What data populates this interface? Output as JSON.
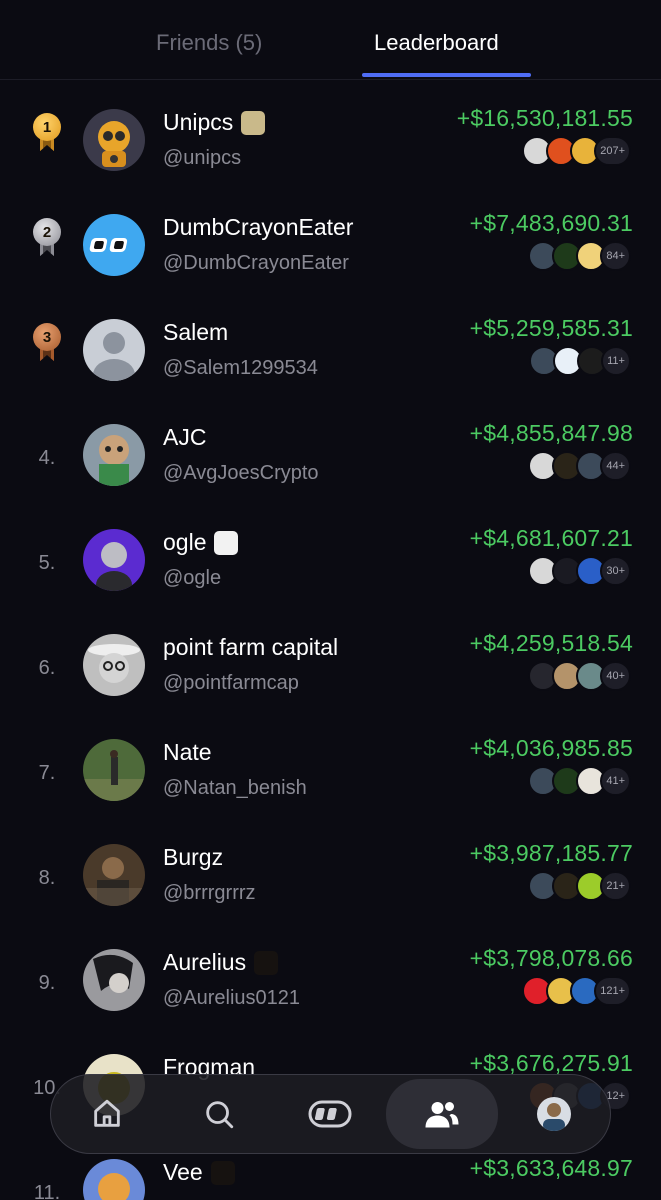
{
  "tabs": {
    "friends": "Friends (5)",
    "leaderboard": "Leaderboard"
  },
  "accent_color": "#4f6df5",
  "gain_color": "#4ccb62",
  "rows": [
    {
      "rank": "1",
      "name": "Unipcs",
      "handle": "@unipcs",
      "amount": "+$16,530,181.55",
      "more": "207+",
      "medal": "gold"
    },
    {
      "rank": "2",
      "name": "DumbCrayonEater",
      "handle": "@DumbCrayonEater",
      "amount": "+$7,483,690.31",
      "more": "84+",
      "medal": "silver"
    },
    {
      "rank": "3",
      "name": "Salem",
      "handle": "@Salem1299534",
      "amount": "+$5,259,585.31",
      "more": "11+",
      "medal": "bronze"
    },
    {
      "rank": "4.",
      "name": "AJC",
      "handle": "@AvgJoesCrypto",
      "amount": "+$4,855,847.98",
      "more": "44+"
    },
    {
      "rank": "5.",
      "name": "ogle",
      "handle": "@ogle",
      "amount": "+$4,681,607.21",
      "more": "30+"
    },
    {
      "rank": "6.",
      "name": "point farm capital",
      "handle": "@pointfarmcap",
      "amount": "+$4,259,518.54",
      "more": "40+"
    },
    {
      "rank": "7.",
      "name": "Nate",
      "handle": "@Natan_benish",
      "amount": "+$4,036,985.85",
      "more": "41+"
    },
    {
      "rank": "8.",
      "name": "Burgz",
      "handle": "@brrrgrrrz",
      "amount": "+$3,987,185.77",
      "more": "21+"
    },
    {
      "rank": "9.",
      "name": "Aurelius",
      "handle": "@Aurelius0121",
      "amount": "+$3,798,078.66",
      "more": "121+"
    },
    {
      "rank": "10.",
      "name": "Frogman",
      "handle": "",
      "amount": "+$3,676,275.91",
      "more": "12+"
    },
    {
      "rank": "11.",
      "name": "Vee",
      "handle": "",
      "amount": "+$3,633,648.97",
      "more": ""
    }
  ],
  "nav": [
    {
      "icon": "home-icon"
    },
    {
      "icon": "search-icon"
    },
    {
      "icon": "app-logo-icon"
    },
    {
      "icon": "friends-icon",
      "active": true
    },
    {
      "icon": "profile-avatar"
    }
  ]
}
